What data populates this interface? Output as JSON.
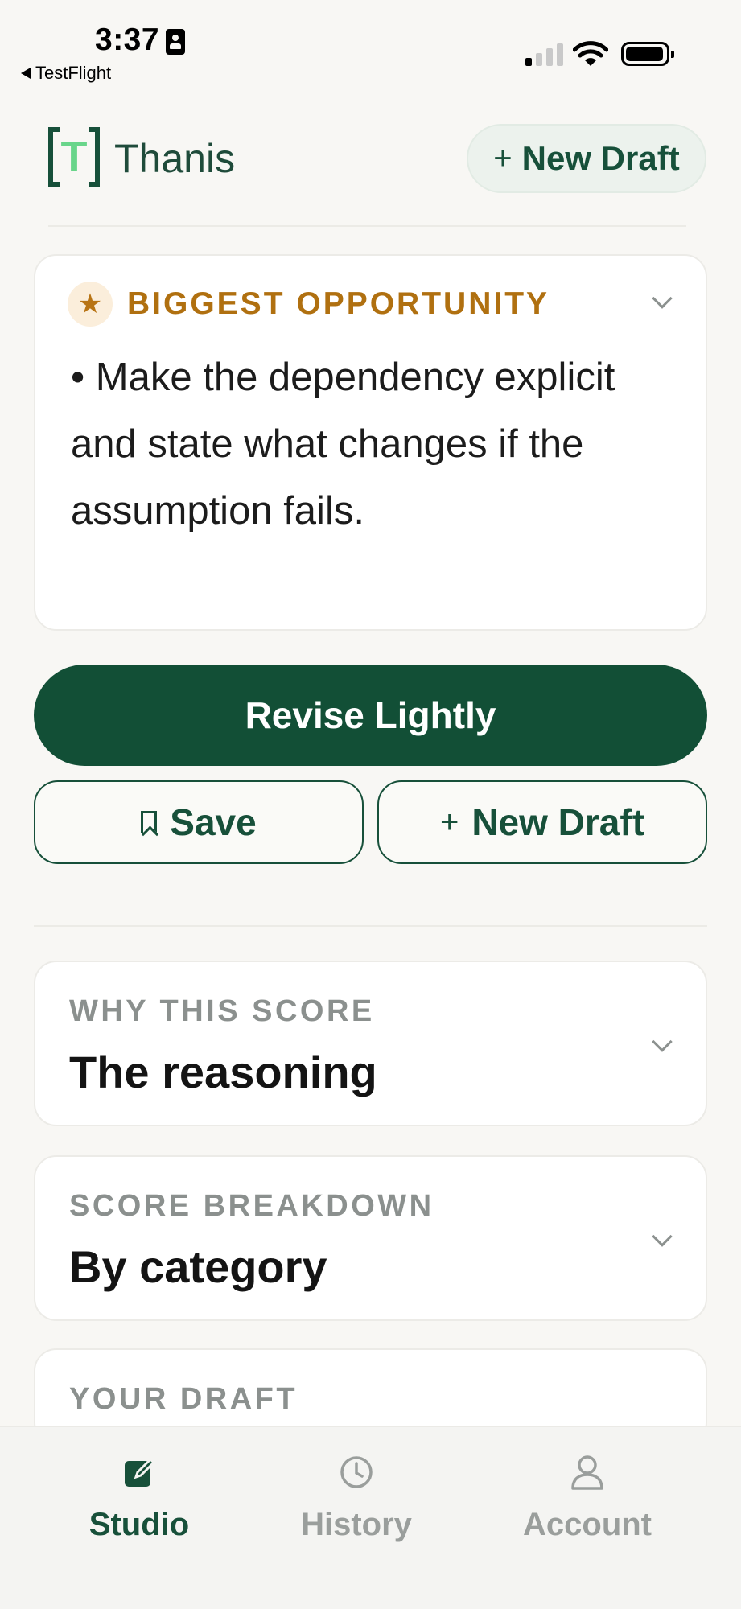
{
  "status_bar": {
    "time": "3:37",
    "back_label": "TestFlight"
  },
  "header": {
    "logo_letter": "T",
    "app_name": "Thanis",
    "new_draft_label": "New Draft"
  },
  "opportunity": {
    "title": "BIGGEST OPPORTUNITY",
    "body": "• Make the dependency explicit and state what changes if the assumption fails.",
    "accent_color": "#b07010"
  },
  "actions": {
    "primary_label": "Revise Lightly",
    "save_label": "Save",
    "new_draft_label": "New Draft"
  },
  "sections": [
    {
      "kicker": "WHY THIS SCORE",
      "title": "The reasoning"
    },
    {
      "kicker": "SCORE BREAKDOWN",
      "title": "By category"
    },
    {
      "kicker": "YOUR DRAFT"
    }
  ],
  "tabs": [
    {
      "label": "Studio",
      "icon": "compose-icon",
      "active": true
    },
    {
      "label": "History",
      "icon": "clock-icon",
      "active": false
    },
    {
      "label": "Account",
      "icon": "person-icon",
      "active": false
    }
  ],
  "colors": {
    "brand": "#124f36",
    "logo_accent": "#69d58a",
    "background": "#f8f7f4"
  }
}
